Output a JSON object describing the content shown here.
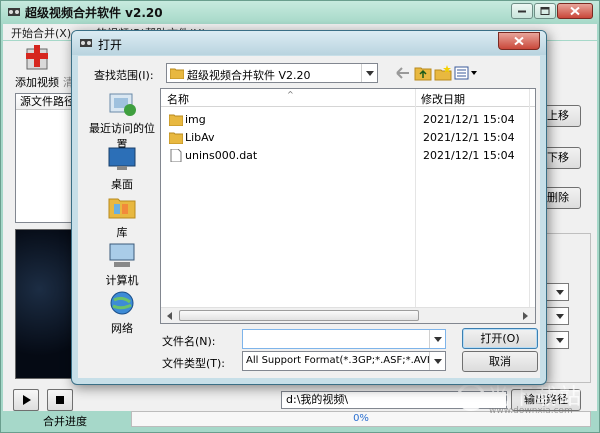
{
  "main_window": {
    "title": "超级视频合并软件 v2.20",
    "menu": [
      "开始合并(X)",
      "…的视频(R)",
      "帮助文件(H)"
    ],
    "toolbar": {
      "add_label": "添加视频",
      "clear_label": "清"
    },
    "list_header": "源文件路径",
    "right_buttons": [
      "上移",
      "下移",
      "删除"
    ],
    "output_path": "d:\\我的视频\\",
    "output_button": "输出路径",
    "progress_label": "合并进度",
    "progress_text": "0%",
    "watermark": {
      "cn": "光下载站",
      "en": "www.downxia.com"
    }
  },
  "dialog": {
    "title": "打开",
    "look_in_label": "查找范围(I):",
    "look_in_value": "超级视频合并软件 V2.20",
    "places": [
      "最近访问的位置",
      "桌面",
      "库",
      "计算机",
      "网络"
    ],
    "columns": {
      "name": "名称",
      "date": "修改日期"
    },
    "files": [
      {
        "name": "img",
        "date": "2021/12/1 15:04",
        "type": "folder"
      },
      {
        "name": "LibAv",
        "date": "2021/12/1 15:04",
        "type": "folder"
      },
      {
        "name": "unins000.dat",
        "date": "2021/12/1 15:04",
        "type": "file"
      }
    ],
    "filename_label": "文件名(N):",
    "filename_value": "",
    "filetype_label": "文件类型(T):",
    "filetype_value": "All Support Format(*.3GP;*.ASF;*.AVI;",
    "open_button": "打开(O)",
    "cancel_button": "取消"
  },
  "colors": {
    "window_frame": "#a6d8c9",
    "dialog_frame": "#c7dfe8",
    "close_red": "#c9473a",
    "progress_text": "#2a6fd0"
  }
}
